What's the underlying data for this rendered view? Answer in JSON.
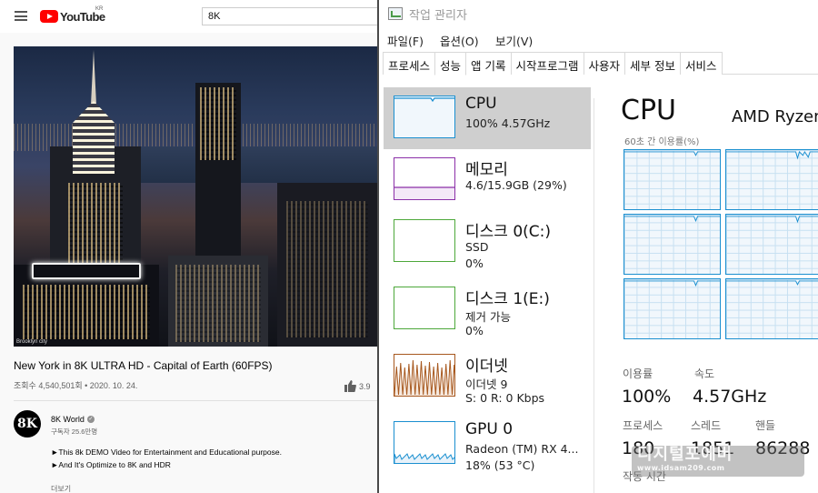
{
  "youtube": {
    "brand": "YouTube",
    "region": "KR",
    "search_value": "8K",
    "video_caption": "Brooklyn city",
    "title": "New York in 8K ULTRA HD - Capital of Earth (60FPS)",
    "meta": "조회수 4,540,501회 • 2020. 10. 24.",
    "likes": "3.9",
    "channel": {
      "avatar_text": "8K",
      "name": "8K World",
      "subscribers": "구독자 25.6만명"
    },
    "description": [
      "►This 8k DEMO Video for  Entertainment and Educational purpose.",
      "►And It's Optimize to 8K and HDR"
    ],
    "more": "더보기"
  },
  "taskmgr": {
    "title": "작업 관리자",
    "menu": [
      "파일(F)",
      "옵션(O)",
      "보기(V)"
    ],
    "tabs": [
      "프로세스",
      "성능",
      "앱 기록",
      "시작프로그램",
      "사용자",
      "세부 정보",
      "서비스"
    ],
    "active_tab": "성능",
    "resources": [
      {
        "name": "CPU",
        "line1": "100% 4.57GHz",
        "line2": "",
        "color": "#1a8fd0"
      },
      {
        "name": "메모리",
        "line1": "4.6/15.9GB (29%)",
        "line2": "",
        "color": "#8b2fa8"
      },
      {
        "name": "디스크 0(C:)",
        "line1": "SSD",
        "line2": "0%",
        "color": "#4da83a"
      },
      {
        "name": "디스크 1(E:)",
        "line1": "제거 가능",
        "line2": "0%",
        "color": "#4da83a"
      },
      {
        "name": "이더넷",
        "line1": "이더넷 9",
        "line2": "S: 0 R:  0 Kbps",
        "color": "#a7581e"
      },
      {
        "name": "GPU 0",
        "line1": "Radeon (TM) RX 4...",
        "line2": "18% (53 °C)",
        "color": "#1a8fd0"
      }
    ],
    "detail": {
      "heading": "CPU",
      "model": "AMD Ryzen",
      "graph_label": "60초 간 이용률(%)",
      "stats": [
        {
          "label": "이용률",
          "value": "100%"
        },
        {
          "label": "속도",
          "value": "4.57GHz"
        },
        {
          "label": "프로세스",
          "value": "180"
        },
        {
          "label": "스레드",
          "value": "1851"
        },
        {
          "label": "핸들",
          "value": "86288"
        }
      ],
      "uptime_label": "작동 시간"
    }
  },
  "watermark": {
    "line1": "디지털포에버",
    "line2": "www.idsam209.com"
  }
}
